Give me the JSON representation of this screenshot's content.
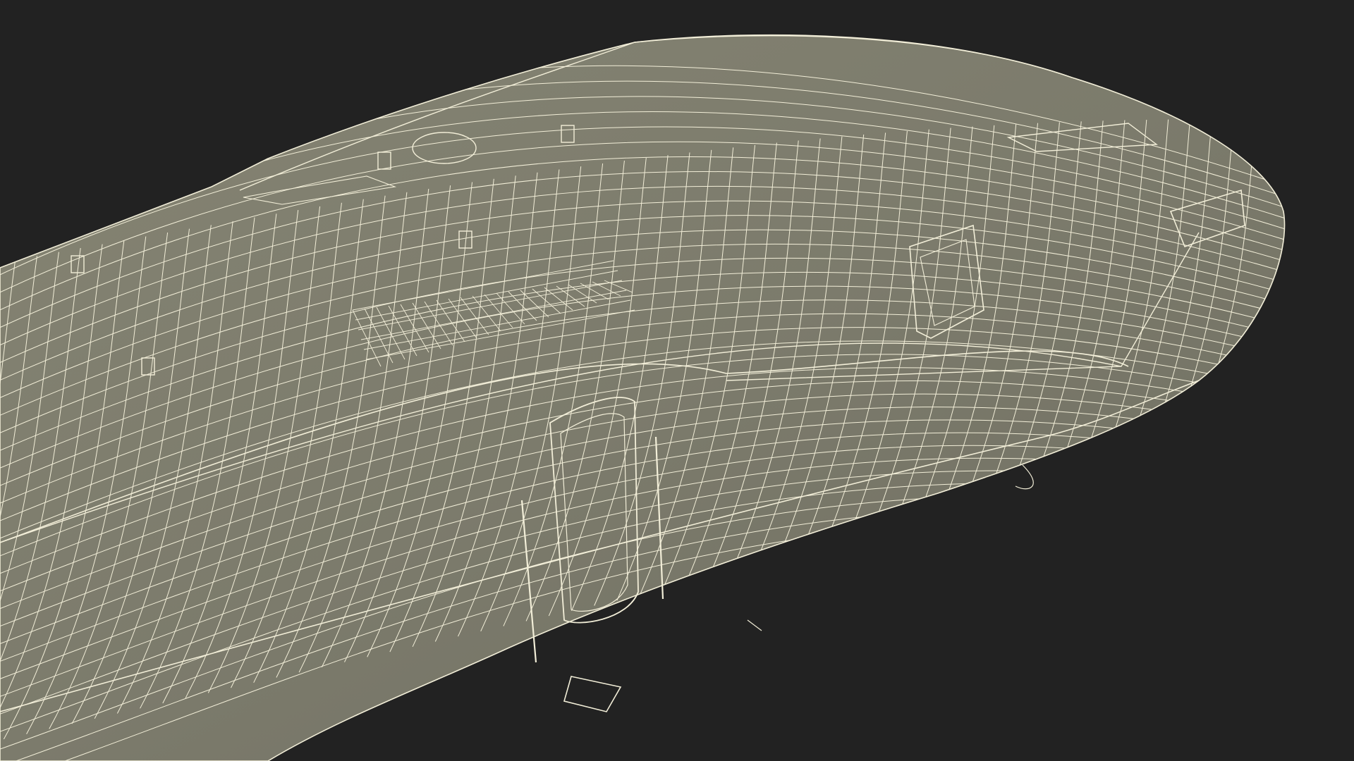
{
  "scene": {
    "subject": "",
    "render_style": "wireframe-over-shaded",
    "colors": {
      "background": "#222222",
      "body_fill": "#7c7b6c",
      "body_fill_shadow": "#6a695c",
      "body_fill_light": "#8a897a",
      "wire": "#f2eed8",
      "wire_dense": "#f7f4e4"
    }
  }
}
